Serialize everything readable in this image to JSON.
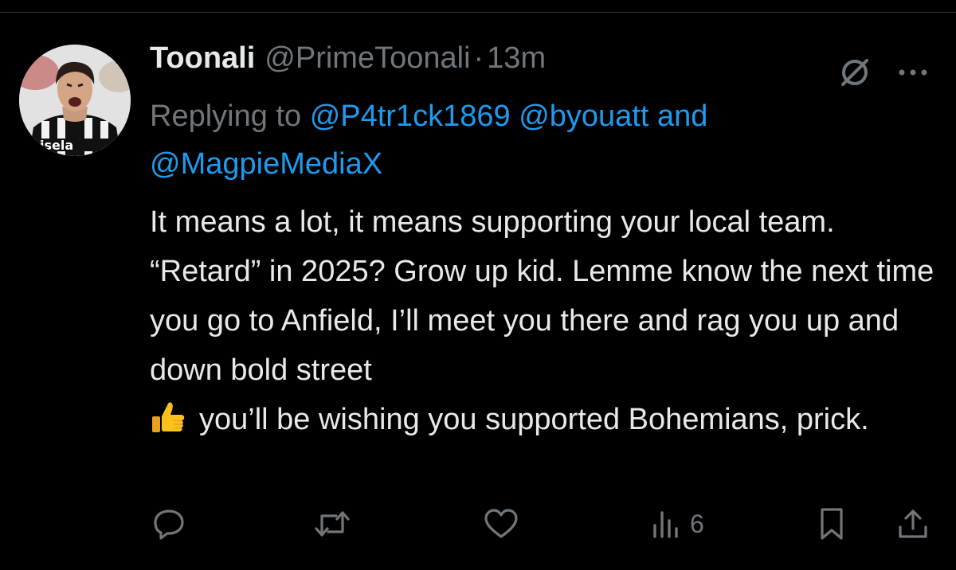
{
  "tweet": {
    "display_name": "Toonali",
    "handle": "@PrimeToonali",
    "separator": "·",
    "time": "13m",
    "reply_prefix": "Replying to",
    "mentions": [
      "@P4tr1ck1869",
      "@byouatt"
    ],
    "reply_and": "and",
    "mention_last": "@MagpieMediaX",
    "body_part1": "It means a lot, it means supporting your local team. “Retard” in 2025? Grow up kid. Lemme know the next time you go to Anfield, I’ll meet you there and rag you up and down bold street",
    "emoji": "thumbs-up-emoji",
    "body_part2": "you’ll be wishing you supported Bohemians, prick.",
    "avatar_text": "isela"
  },
  "actions": {
    "reply_icon": "reply-icon",
    "retweet_icon": "retweet-icon",
    "like_icon": "heart-icon",
    "views_icon": "views-icon",
    "views_count": "6",
    "bookmark_icon": "bookmark-icon",
    "share_icon": "share-icon"
  },
  "colors": {
    "background": "#000000",
    "text": "#e7e9ea",
    "muted": "#71767b",
    "link": "#1d9bf0"
  }
}
